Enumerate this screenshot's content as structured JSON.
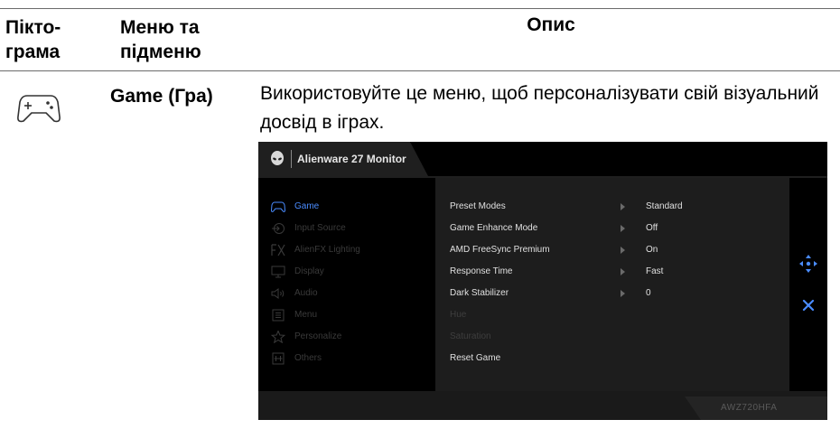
{
  "table": {
    "headers": {
      "pictogram": [
        "Пікто-",
        "грама"
      ],
      "menu": [
        "Меню та",
        "підменю"
      ],
      "description": "Опис"
    },
    "row": {
      "icon": "gamepad-icon",
      "menu_name": "Game (Гра)",
      "description": "Використовуйте це меню, щоб персоналізувати свій візуальний досвід в іграх."
    }
  },
  "osd": {
    "title": "Alienware 27 Monitor",
    "model": "AWZ720HFA",
    "accent_color": "#4a8cff",
    "menu": [
      {
        "label": "Game",
        "icon": "gamepad-icon",
        "active": true
      },
      {
        "label": "Input Source",
        "icon": "input-icon",
        "active": false
      },
      {
        "label": "AlienFX Lighting",
        "icon": "fx-icon",
        "active": false
      },
      {
        "label": "Display",
        "icon": "monitor-icon",
        "active": false
      },
      {
        "label": "Audio",
        "icon": "speaker-icon",
        "active": false
      },
      {
        "label": "Menu",
        "icon": "menu-icon",
        "active": false
      },
      {
        "label": "Personalize",
        "icon": "star-icon",
        "active": false
      },
      {
        "label": "Others",
        "icon": "others-icon",
        "active": false
      }
    ],
    "settings": [
      {
        "label": "Preset Modes",
        "value": "Standard",
        "enabled": true
      },
      {
        "label": "Game Enhance Mode",
        "value": "Off",
        "enabled": true
      },
      {
        "label": "AMD FreeSync Premium",
        "value": "On",
        "enabled": true
      },
      {
        "label": "Response Time",
        "value": "Fast",
        "enabled": true
      },
      {
        "label": "Dark Stabilizer",
        "value": "0",
        "enabled": true
      },
      {
        "label": "Hue",
        "value": "",
        "enabled": false
      },
      {
        "label": "Saturation",
        "value": "",
        "enabled": false
      },
      {
        "label": "Reset Game",
        "value": "",
        "enabled": true
      }
    ],
    "side_icons": [
      "navigate-icon",
      "close-icon"
    ]
  }
}
